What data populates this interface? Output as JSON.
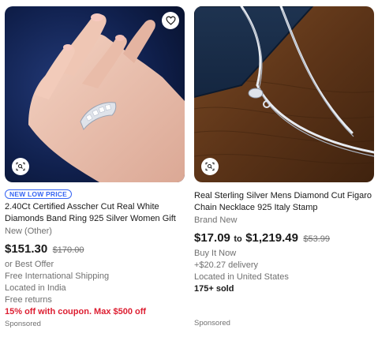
{
  "items": [
    {
      "badge": "NEW LOW PRICE",
      "title": "2.40Ct Certified Asscher Cut Real White Diamonds Band Ring 925 Silver Women Gift",
      "condition": "New (Other)",
      "price": "$151.30",
      "original_price": "$170.00",
      "details": [
        "or Best Offer",
        "Free International Shipping",
        "Located in India",
        "Free returns"
      ],
      "coupon": "15% off with coupon. Max $500 off",
      "sponsored": "Sponsored",
      "icons": {
        "favorite": "heart-icon",
        "visual_search": "camera-search-icon"
      }
    },
    {
      "title": "Real Sterling Silver Mens Diamond Cut Figaro Chain Necklace 925 Italy Stamp",
      "condition": "Brand New",
      "price_low": "$17.09",
      "price_to": "to",
      "price_high": "$1,219.49",
      "original_price": "$53.99",
      "details": [
        "Buy It Now",
        "+$20.27 delivery",
        "Located in United States"
      ],
      "sold": "175+ sold",
      "sponsored": "Sponsored",
      "icons": {
        "visual_search": "camera-search-icon"
      }
    }
  ],
  "colors": {
    "link_blue": "#3665f3",
    "coupon_red": "#dd1e31",
    "secondary_text": "#707070",
    "primary_text": "#191919"
  }
}
